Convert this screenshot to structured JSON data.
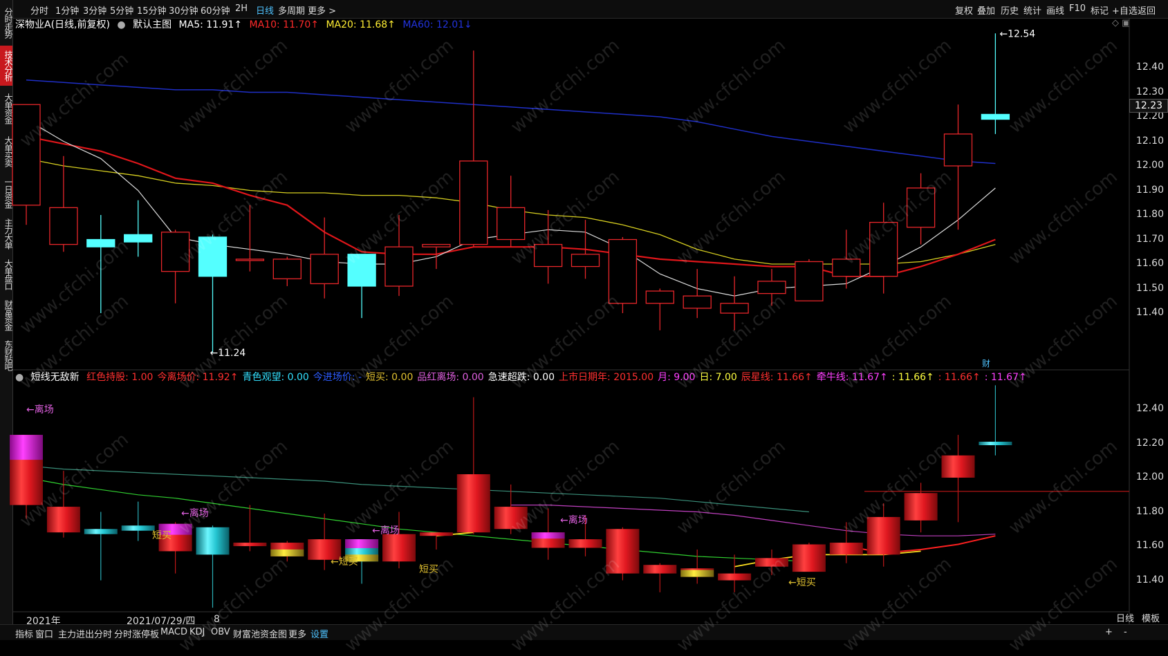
{
  "left_tabs": [
    "分时走势",
    "技术分析",
    "大单资金",
    "大单买卖",
    "一日资金",
    "主力大单",
    "大单盘口",
    "财富资金",
    "东财贴吧"
  ],
  "period_bar": [
    "分时",
    "1分钟",
    "3分钟",
    "5分钟",
    "15分钟",
    "30分钟",
    "60分钟",
    "2H",
    "日线",
    "多周期",
    "更多 >"
  ],
  "active_period": "日线",
  "right_tools": [
    "复权",
    "叠加",
    "历史",
    "统计",
    "画线",
    "F10",
    "标记",
    "+自选",
    "返回"
  ],
  "main_legend": {
    "title": "深物业A(日线,前复权)",
    "chart_name": "默认主图",
    "ma5": "MA5: 11.91↑",
    "ma10": "MA10: 11.70↑",
    "ma20": "MA20: 11.68↑",
    "ma60": "MA60: 12.01↓"
  },
  "sub_legend": {
    "name": "短线无敌新",
    "items": [
      {
        "text": "红色持股: 1.00",
        "color": "#ff3030"
      },
      {
        "text": "今离场价: 11.92↑",
        "color": "#ff3030"
      },
      {
        "text": "青色观望: 0.00",
        "color": "#33e0ff"
      },
      {
        "text": "今进场价: -",
        "color": "#2d5cff"
      },
      {
        "text": "短买: 0.00",
        "color": "#e0c030"
      },
      {
        "text": "品红离场: 0.00",
        "color": "#e060e0"
      },
      {
        "text": "急速超跌: 0.00",
        "color": "#ffffff"
      },
      {
        "text": "上市日期年: 2015.00",
        "color": "#ff3030"
      },
      {
        "text": "月: 9.00",
        "color": "#ff40ff"
      },
      {
        "text": "日: 7.00",
        "color": "#ffff40"
      },
      {
        "text": "辰星线: 11.66↑",
        "color": "#ff3030"
      },
      {
        "text": "牵牛线: 11.67↑",
        "color": "#ff40ff"
      },
      {
        "text": ": 11.66↑",
        "color": "#ffff40"
      },
      {
        "text": ": 11.66↑",
        "color": "#ff3030"
      },
      {
        "text": ": 11.67↑",
        "color": "#ff40ff"
      }
    ]
  },
  "price_axis_main": [
    "12.40",
    "12.30",
    "12.20",
    "12.10",
    "12.00",
    "11.90",
    "11.80",
    "11.70",
    "11.60",
    "11.50",
    "11.40"
  ],
  "price_axis_sub": [
    "12.40",
    "12.20",
    "12.00",
    "11.80",
    "11.60",
    "11.40"
  ],
  "current_price": "12.23",
  "max_label": "12.54",
  "min_label": "11.24",
  "fin_marker": "财",
  "sub_signals": [
    "←离场",
    "←离场",
    "←离场",
    "←离场",
    "短买",
    "←短买",
    "短买",
    "←短买"
  ],
  "dates": [
    "2021年",
    "2021/07/29/四",
    "8"
  ],
  "bottom_tabs": [
    "指标",
    "窗口",
    "主力进出分时",
    "分时涨停板",
    "MACD",
    "KDJ",
    "OBV",
    "财富池资金图",
    "更多",
    "设置"
  ],
  "bottom_right": [
    "日线",
    "模板",
    "+",
    "-"
  ],
  "watermark": "www.cfchi.com",
  "chart_data": {
    "type": "candlestick",
    "candles": [
      {
        "o": 11.84,
        "h": 12.25,
        "l": 11.76,
        "c": 12.25
      },
      {
        "o": 11.68,
        "h": 12.04,
        "l": 11.65,
        "c": 11.83
      },
      {
        "o": 11.7,
        "h": 11.8,
        "l": 11.4,
        "c": 11.67
      },
      {
        "o": 11.72,
        "h": 11.86,
        "l": 11.63,
        "c": 11.69
      },
      {
        "o": 11.57,
        "h": 11.74,
        "l": 11.44,
        "c": 11.73
      },
      {
        "o": 11.71,
        "h": 11.72,
        "l": 11.24,
        "c": 11.55
      },
      {
        "o": 11.62,
        "h": 11.84,
        "l": 11.57,
        "c": 11.62
      },
      {
        "o": 11.54,
        "h": 11.63,
        "l": 11.51,
        "c": 11.62
      },
      {
        "o": 11.52,
        "h": 11.79,
        "l": 11.46,
        "c": 11.64
      },
      {
        "o": 11.64,
        "h": 11.64,
        "l": 11.38,
        "c": 11.51
      },
      {
        "o": 11.51,
        "h": 11.8,
        "l": 11.47,
        "c": 11.67
      },
      {
        "o": 11.67,
        "h": 11.68,
        "l": 11.58,
        "c": 11.68
      },
      {
        "o": 11.68,
        "h": 12.47,
        "l": 11.67,
        "c": 12.02
      },
      {
        "o": 11.7,
        "h": 11.96,
        "l": 11.67,
        "c": 11.83
      },
      {
        "o": 11.59,
        "h": 11.82,
        "l": 11.52,
        "c": 11.68
      },
      {
        "o": 11.59,
        "h": 11.78,
        "l": 11.54,
        "c": 11.64
      },
      {
        "o": 11.44,
        "h": 11.71,
        "l": 11.4,
        "c": 11.7
      },
      {
        "o": 11.44,
        "h": 11.5,
        "l": 11.33,
        "c": 11.49
      },
      {
        "o": 11.42,
        "h": 11.58,
        "l": 11.38,
        "c": 11.47
      },
      {
        "o": 11.4,
        "h": 11.55,
        "l": 11.33,
        "c": 11.44
      },
      {
        "o": 11.48,
        "h": 11.58,
        "l": 11.43,
        "c": 11.53
      },
      {
        "o": 11.45,
        "h": 11.62,
        "l": 11.45,
        "c": 11.61
      },
      {
        "o": 11.55,
        "h": 11.74,
        "l": 11.5,
        "c": 11.62
      },
      {
        "o": 11.55,
        "h": 11.85,
        "l": 11.48,
        "c": 11.77
      },
      {
        "o": 11.75,
        "h": 11.97,
        "l": 11.68,
        "c": 11.91
      },
      {
        "o": 12.0,
        "h": 12.25,
        "l": 11.74,
        "c": 12.13
      },
      {
        "o": 12.21,
        "h": 12.54,
        "l": 12.13,
        "c": 12.19
      }
    ],
    "ma5": [
      12.19,
      12.1,
      12.03,
      11.9,
      11.71,
      11.68,
      11.66,
      11.64,
      11.61,
      11.6,
      11.6,
      11.63,
      11.7,
      11.72,
      11.74,
      11.73,
      11.66,
      11.56,
      11.5,
      11.47,
      11.5,
      11.51,
      11.52,
      11.59,
      11.67,
      11.78,
      11.91
    ],
    "ma10": [
      12.12,
      12.09,
      12.06,
      12.01,
      11.95,
      11.93,
      11.88,
      11.84,
      11.73,
      11.65,
      11.64,
      11.64,
      11.67,
      11.67,
      11.67,
      11.66,
      11.64,
      11.62,
      11.61,
      11.6,
      11.59,
      11.59,
      11.55,
      11.55,
      11.59,
      11.64,
      11.7
    ],
    "ma20": [
      12.03,
      12.0,
      11.98,
      11.96,
      11.93,
      11.92,
      11.9,
      11.89,
      11.89,
      11.88,
      11.88,
      11.87,
      11.85,
      11.82,
      11.8,
      11.79,
      11.76,
      11.72,
      11.66,
      11.62,
      11.6,
      11.6,
      11.6,
      11.6,
      11.61,
      11.64,
      11.68
    ],
    "ma60": [
      12.35,
      12.34,
      12.33,
      12.32,
      12.31,
      12.31,
      12.3,
      12.3,
      12.29,
      12.28,
      12.27,
      12.26,
      12.25,
      12.24,
      12.23,
      12.22,
      12.21,
      12.2,
      12.18,
      12.15,
      12.12,
      12.1,
      12.08,
      12.06,
      12.04,
      12.02,
      12.01
    ]
  }
}
